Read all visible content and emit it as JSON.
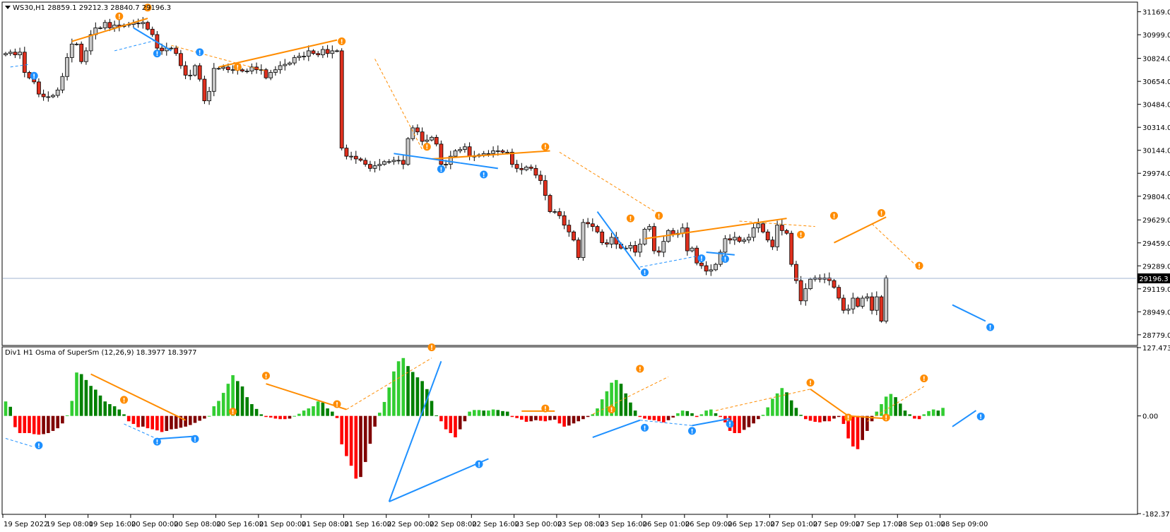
{
  "chart_data": [
    {
      "type": "candlestick",
      "header": "WS30,H1  28859.1 29212.3 28840.7 29196.3",
      "symbol": "WS30",
      "timeframe": "H1",
      "ohlc_last": [
        28859.1,
        29212.3,
        28840.7,
        29196.3
      ],
      "current_price_label": "29196.3",
      "current_price": 29196.3,
      "ylim": [
        28705,
        31235
      ],
      "y_tick_labels": [
        "31169.0",
        "30999.0",
        "30824.0",
        "30654.0",
        "30484.0",
        "30314.0",
        "30144.0",
        "29974.0",
        "29804.0",
        "29629.0",
        "29459.0",
        "29289.0",
        "29119.0",
        "28949.0",
        "28779.0"
      ],
      "closes": [
        30860,
        30870,
        30850,
        30870,
        30720,
        30680,
        30650,
        30560,
        30540,
        30540,
        30550,
        30590,
        30690,
        30830,
        30930,
        30930,
        30800,
        30880,
        31000,
        31050,
        31050,
        31090,
        31050,
        31070,
        31060,
        31070,
        31075,
        31085,
        31080,
        31090,
        31040,
        31000,
        30900,
        30880,
        30900,
        30900,
        30860,
        30770,
        30700,
        30700,
        30770,
        30670,
        30510,
        30580,
        30750,
        30750,
        30760,
        30740,
        30740,
        30740,
        30730,
        30730,
        30760,
        30740,
        30740,
        30680,
        30720,
        30740,
        30770,
        30780,
        30790,
        30830,
        30840,
        30840,
        30880,
        30860,
        30850,
        30890,
        30860,
        30880,
        30880,
        30160,
        30100,
        30100,
        30080,
        30070,
        30040,
        30010,
        30030,
        30040,
        30060,
        30060,
        30070,
        30070,
        30040,
        30230,
        30310,
        30280,
        30210,
        30220,
        30240,
        30190,
        30040,
        30040,
        30100,
        30140,
        30150,
        30170,
        30100,
        30100,
        30110,
        30120,
        30120,
        30140,
        30140,
        30130,
        30130,
        30040,
        30010,
        30000,
        30020,
        30010,
        29960,
        29920,
        29810,
        29690,
        29690,
        29660,
        29590,
        29540,
        29480,
        29350,
        29610,
        29600,
        29580,
        29540,
        29460,
        29450,
        29500,
        29450,
        29420,
        29420,
        29440,
        29390,
        29450,
        29560,
        29580,
        29400,
        29390,
        29470,
        29550,
        29520,
        29530,
        29570,
        29400,
        29420,
        29310,
        29290,
        29250,
        29260,
        29300,
        29390,
        29490,
        29480,
        29500,
        29470,
        29480,
        29500,
        29570,
        29600,
        29540,
        29480,
        29430,
        29590,
        29550,
        29530,
        29300,
        29180,
        29030,
        29120,
        29190,
        29200,
        29190,
        29200,
        29180,
        29130,
        29050,
        28960,
        28970,
        29050,
        28990,
        29050,
        29060,
        28960,
        29060,
        28880,
        29200
      ],
      "hist": [
        27,
        17,
        -21,
        -32,
        -32,
        -32,
        -34,
        -35,
        -34,
        -32,
        -28,
        -23,
        -14,
        1,
        28,
        81,
        78,
        67,
        56,
        49,
        38,
        27,
        22,
        18,
        12,
        3,
        -10,
        -15,
        -21,
        -20,
        -23,
        -25,
        -27,
        -30,
        -28,
        -25,
        -24,
        -22,
        -20,
        -17,
        -13,
        -9,
        -5,
        0,
        18,
        28,
        43,
        60,
        76,
        65,
        55,
        35,
        22,
        13,
        3,
        -2,
        -3,
        -5,
        -6,
        -6,
        -5,
        0,
        4,
        10,
        14,
        18,
        27,
        25,
        14,
        8,
        -4,
        -53,
        -75,
        -93,
        -117,
        -114,
        -86,
        -52,
        -20,
        6,
        26,
        53,
        83,
        102,
        108,
        93,
        82,
        72,
        65,
        50,
        28,
        1,
        -10,
        -25,
        -32,
        -40,
        -25,
        -10,
        8,
        11,
        11,
        10,
        10,
        12,
        11,
        9,
        8,
        -2,
        -4,
        -7,
        -11,
        -10,
        -8,
        -9,
        -10,
        -8,
        -7,
        -14,
        -20,
        -18,
        -14,
        -10,
        -6,
        -2,
        3,
        14,
        31,
        46,
        62,
        67,
        60,
        42,
        25,
        10,
        -2,
        -5,
        -7,
        -8,
        -10,
        -12,
        -8,
        -3,
        5,
        10,
        9,
        5,
        -2,
        3,
        10,
        12,
        5,
        -2,
        -12,
        -28,
        -32,
        -32,
        -26,
        -21,
        -14,
        -6,
        2,
        16,
        32,
        42,
        52,
        44,
        29,
        15,
        2,
        -6,
        -9,
        -11,
        -12,
        -10,
        -10,
        -5,
        -2,
        -15,
        -42,
        -57,
        -62,
        -45,
        -28,
        -10,
        8,
        22,
        36,
        41,
        35,
        23,
        10,
        3,
        -5,
        -6,
        3,
        9,
        12,
        10,
        15
      ],
      "color_map": {
        "body_up": "#c8c8c8",
        "body_down": "#e0301e",
        "hist_pos_rising": "#32cd32",
        "hist_pos_falling": "#008000",
        "hist_neg_falling": "#ff0000",
        "hist_neg_rising": "#800000",
        "bull_div": "#ff8c00",
        "bear_div": "#1e90ff"
      }
    },
    {
      "type": "bar",
      "header": "Div1 H1 Osma of SuperSm (12,26,9) 18.3977 18.3977",
      "ylim": [
        -182.373,
        127.4732
      ],
      "y_tick_labels": [
        "127.4732",
        "0.00",
        "-182.373"
      ]
    }
  ],
  "x_tick_labels": [
    "19 Sep 2022",
    "19 Sep 08:00",
    "19 Sep 16:00",
    "20 Sep 00:00",
    "20 Sep 08:00",
    "20 Sep 16:00",
    "21 Sep 00:00",
    "21 Sep 08:00",
    "21 Sep 16:00",
    "22 Sep 00:00",
    "22 Sep 08:00",
    "22 Sep 16:00",
    "23 Sep 00:00",
    "23 Sep 08:00",
    "23 Sep 16:00",
    "26 Sep 01:00",
    "26 Sep 09:00",
    "26 Sep 17:00",
    "27 Sep 01:00",
    "27 Sep 09:00",
    "27 Sep 17:00",
    "28 Sep 01:00",
    "28 Sep 09:00"
  ],
  "divergence_lines": [
    {
      "kind": "bull",
      "style": "solid",
      "pane": "price",
      "from": [
        14,
        30950
      ],
      "to": [
        30,
        31120
      ]
    },
    {
      "kind": "bull",
      "style": "solid",
      "pane": "price",
      "from": [
        45,
        30760
      ],
      "to": [
        70,
        30960
      ]
    },
    {
      "kind": "bull",
      "style": "solid",
      "pane": "price",
      "from": [
        90,
        30080
      ],
      "to": [
        115,
        30140
      ]
    },
    {
      "kind": "bull",
      "style": "solid",
      "pane": "price",
      "from": [
        135,
        29490
      ],
      "to": [
        165,
        29640
      ]
    },
    {
      "kind": "bull",
      "style": "solid",
      "pane": "price",
      "from": [
        175,
        29460
      ],
      "to": [
        186,
        29650
      ]
    },
    {
      "kind": "bear",
      "style": "solid",
      "pane": "price",
      "from": [
        27,
        31050
      ],
      "to": [
        35,
        30880
      ]
    },
    {
      "kind": "bear",
      "style": "solid",
      "pane": "price",
      "from": [
        82,
        30120
      ],
      "to": [
        96,
        30050
      ]
    },
    {
      "kind": "bear",
      "style": "solid",
      "pane": "price",
      "from": [
        96,
        30050
      ],
      "to": [
        104,
        30010
      ]
    },
    {
      "kind": "bear",
      "style": "solid",
      "pane": "price",
      "from": [
        125,
        29690
      ],
      "to": [
        134,
        29260
      ]
    },
    {
      "kind": "bear",
      "style": "solid",
      "pane": "price",
      "from": [
        148,
        29390
      ],
      "to": [
        154,
        29370
      ]
    },
    {
      "kind": "bear",
      "style": "solid",
      "pane": "price",
      "from": [
        200,
        29000
      ],
      "to": [
        207,
        28880
      ]
    },
    {
      "kind": "bull",
      "style": "dashed",
      "pane": "price",
      "from": [
        35,
        30920
      ],
      "to": [
        55,
        30730
      ]
    },
    {
      "kind": "bull",
      "style": "dashed",
      "pane": "price",
      "from": [
        78,
        30820
      ],
      "to": [
        88,
        30150
      ]
    },
    {
      "kind": "bull",
      "style": "dashed",
      "pane": "price",
      "from": [
        117,
        30130
      ],
      "to": [
        139,
        29650
      ]
    },
    {
      "kind": "bull",
      "style": "dashed",
      "pane": "price",
      "from": [
        155,
        29620
      ],
      "to": [
        171,
        29580
      ]
    },
    {
      "kind": "bull",
      "style": "dashed",
      "pane": "price",
      "from": [
        183,
        29600
      ],
      "to": [
        193,
        29270
      ]
    },
    {
      "kind": "bear",
      "style": "dashed",
      "pane": "price",
      "from": [
        1,
        30760
      ],
      "to": [
        5,
        30780
      ]
    },
    {
      "kind": "bear",
      "style": "dashed",
      "pane": "price",
      "from": [
        23,
        30880
      ],
      "to": [
        32,
        30960
      ]
    },
    {
      "kind": "bear",
      "style": "dashed",
      "pane": "price",
      "from": [
        134,
        29280
      ],
      "to": [
        146,
        29360
      ]
    },
    {
      "kind": "bull",
      "style": "solid",
      "pane": "osc",
      "from": [
        18,
        78
      ],
      "to": [
        38,
        -8
      ]
    },
    {
      "kind": "bull",
      "style": "solid",
      "pane": "osc",
      "from": [
        55,
        60
      ],
      "to": [
        72,
        12
      ]
    },
    {
      "kind": "bull",
      "style": "solid",
      "pane": "osc",
      "from": [
        109,
        9
      ],
      "to": [
        116,
        9
      ]
    },
    {
      "kind": "bull",
      "style": "solid",
      "pane": "osc",
      "from": [
        170,
        50
      ],
      "to": [
        178,
        0
      ]
    },
    {
      "kind": "bull",
      "style": "solid",
      "pane": "osc",
      "from": [
        178,
        0
      ],
      "to": [
        186,
        -5
      ]
    },
    {
      "kind": "bear",
      "style": "solid",
      "pane": "osc",
      "from": [
        32,
        -43
      ],
      "to": [
        40,
        -38
      ]
    },
    {
      "kind": "bear",
      "style": "solid",
      "pane": "osc",
      "from": [
        81,
        -160
      ],
      "to": [
        92,
        102
      ]
    },
    {
      "kind": "bear",
      "style": "solid",
      "pane": "osc",
      "from": [
        81,
        -160
      ],
      "to": [
        102,
        -80
      ]
    },
    {
      "kind": "bear",
      "style": "solid",
      "pane": "osc",
      "from": [
        124,
        -40
      ],
      "to": [
        134,
        -8
      ]
    },
    {
      "kind": "bear",
      "style": "solid",
      "pane": "osc",
      "from": [
        145,
        -18
      ],
      "to": [
        153,
        -5
      ]
    },
    {
      "kind": "bear",
      "style": "solid",
      "pane": "osc",
      "from": [
        200,
        -20
      ],
      "to": [
        205,
        10
      ]
    },
    {
      "kind": "bull",
      "style": "dashed",
      "pane": "osc",
      "from": [
        72,
        12
      ],
      "to": [
        90,
        108
      ]
    },
    {
      "kind": "bull",
      "style": "dashed",
      "pane": "osc",
      "from": [
        124,
        3
      ],
      "to": [
        140,
        73
      ]
    },
    {
      "kind": "bull",
      "style": "dashed",
      "pane": "osc",
      "from": [
        150,
        10
      ],
      "to": [
        170,
        50
      ]
    },
    {
      "kind": "bull",
      "style": "dashed",
      "pane": "osc",
      "from": [
        182,
        -10
      ],
      "to": [
        194,
        55
      ]
    },
    {
      "kind": "bear",
      "style": "dashed",
      "pane": "osc",
      "from": [
        0,
        -42
      ],
      "to": [
        6,
        -58
      ]
    },
    {
      "kind": "bear",
      "style": "dashed",
      "pane": "osc",
      "from": [
        25,
        -15
      ],
      "to": [
        32,
        -43
      ]
    },
    {
      "kind": "bear",
      "style": "dashed",
      "pane": "osc",
      "from": [
        134,
        -8
      ],
      "to": [
        145,
        -18
      ]
    }
  ],
  "bull_markers": [
    [
      24,
      31135
    ],
    [
      30,
      31200
    ],
    [
      49,
      30760
    ],
    [
      71,
      30950
    ],
    [
      89,
      30170
    ],
    [
      114,
      30170
    ],
    [
      132,
      29640
    ],
    [
      138,
      29660
    ],
    [
      168,
      29520
    ],
    [
      175,
      29660
    ],
    [
      185,
      29680
    ],
    [
      193,
      29290
    ]
  ],
  "bear_markers": [
    [
      6,
      30695
    ],
    [
      32,
      30860
    ],
    [
      41,
      30870
    ],
    [
      92,
      30005
    ],
    [
      101,
      29965
    ],
    [
      135,
      29240
    ],
    [
      147,
      29345
    ],
    [
      152,
      29340
    ],
    [
      208,
      28835
    ]
  ],
  "osc_bull_markers": [
    [
      25,
      30
    ],
    [
      55,
      75
    ],
    [
      70,
      22
    ],
    [
      48,
      8
    ],
    [
      90,
      128
    ],
    [
      114,
      14
    ],
    [
      134,
      88
    ],
    [
      128,
      12
    ],
    [
      170,
      62
    ],
    [
      178,
      -3
    ],
    [
      186,
      -3
    ],
    [
      194,
      70
    ]
  ],
  "osc_bear_markers": [
    [
      7,
      -55
    ],
    [
      32,
      -48
    ],
    [
      40,
      -43
    ],
    [
      100,
      -90
    ],
    [
      135,
      -22
    ],
    [
      145,
      -28
    ],
    [
      153,
      -15
    ],
    [
      206,
      -1
    ]
  ],
  "marker_glyph": "!"
}
